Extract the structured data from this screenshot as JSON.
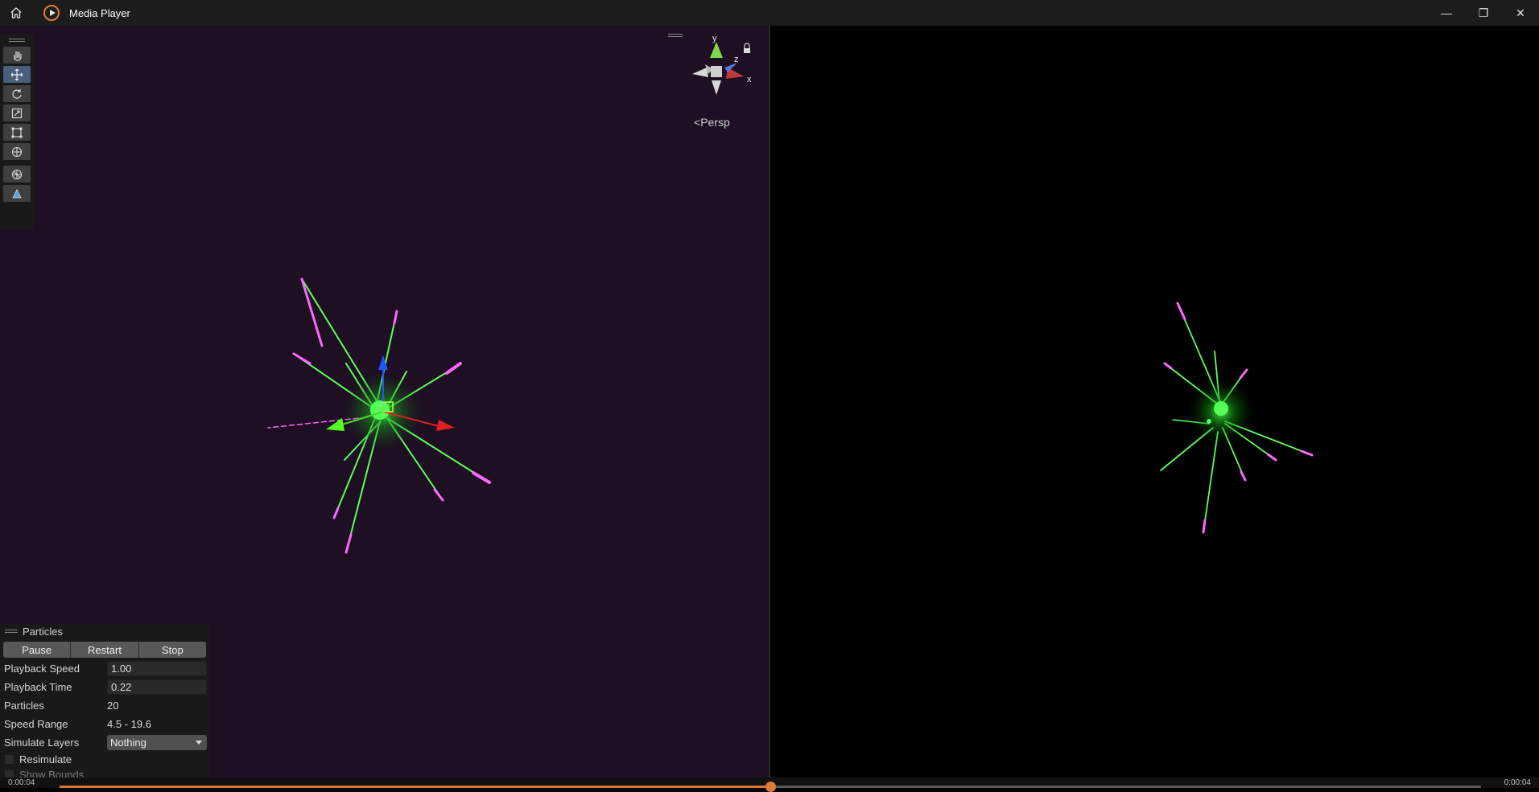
{
  "app": {
    "title": "Media Player"
  },
  "window_controls": {
    "minimize": "—",
    "restore": "❐",
    "close": "✕"
  },
  "scene": {
    "tools": [
      "hand-tool",
      "move-tool",
      "rotate-tool",
      "scale-tool",
      "rect-tool",
      "transform-tool",
      "custom-tool",
      "editor-tool"
    ],
    "active_tool": "move-tool",
    "gizmo_labels": {
      "y": "y",
      "z": "z",
      "x": "x"
    },
    "projection": "Persp"
  },
  "particles_panel": {
    "title": "Particles",
    "buttons": {
      "pause": "Pause",
      "restart": "Restart",
      "stop": "Stop"
    },
    "playback_speed": {
      "label": "Playback Speed",
      "value": "1.00"
    },
    "playback_time": {
      "label": "Playback Time",
      "value": "0.22"
    },
    "particles": {
      "label": "Particles",
      "value": "20"
    },
    "speed_range": {
      "label": "Speed Range",
      "value": "4.5 - 19.6"
    },
    "simulate_layers": {
      "label": "Simulate Layers",
      "value": "Nothing"
    },
    "resimulate": {
      "label": "Resimulate",
      "checked": false
    },
    "show_bounds": {
      "label": "Show Bounds",
      "checked": false
    }
  },
  "playback": {
    "current_time": "0:00:04",
    "total_time": "0:00:04",
    "progress": 0.5
  },
  "colors": {
    "accent": "#e07a3a",
    "scene_bg": "#1e0f23",
    "game_bg": "#000000",
    "particle_green": "#4dff4d",
    "particle_pink": "#ff66ff"
  }
}
